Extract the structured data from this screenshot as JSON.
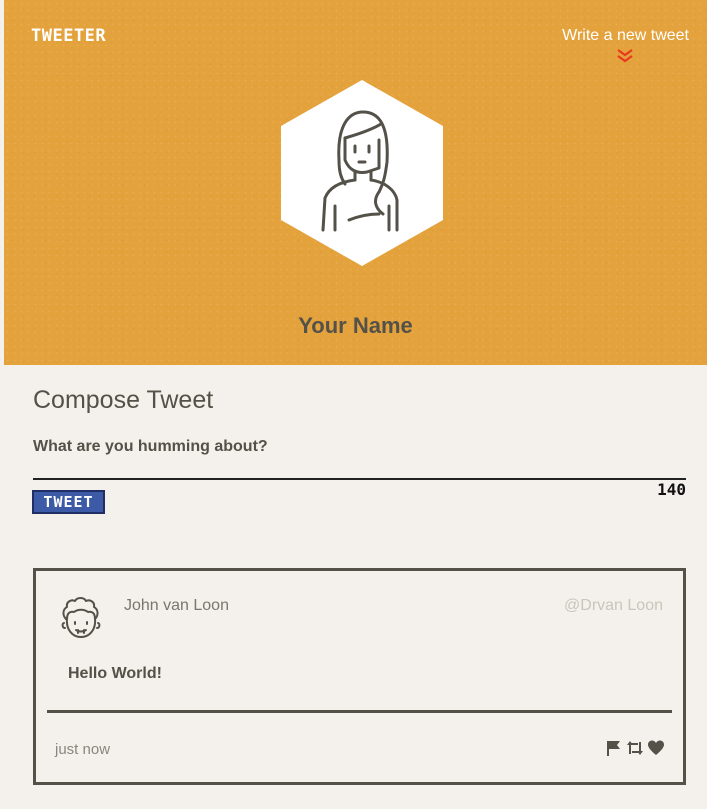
{
  "header": {
    "brand": "TWEETER",
    "write_link": "Write a new tweet",
    "profile_name": "Your Name"
  },
  "compose": {
    "title": "Compose Tweet",
    "label": "What are you humming about?",
    "input_value": "",
    "counter": "140",
    "button_label": "TWEET"
  },
  "tweets": [
    {
      "author": "John van Loon",
      "handle": "@Drvan Loon",
      "body": "Hello World!",
      "time": "just now"
    }
  ],
  "icons": {
    "write_link": "double-chevron-down-icon",
    "avatar": "girl-avatar-icon",
    "tweet_avatar": "curly-hair-man-avatar-icon",
    "actions": [
      "flag-icon",
      "retweet-icon",
      "heart-icon"
    ]
  },
  "colors": {
    "header_bg": "#e4a23c",
    "page_bg": "#f4f1ec",
    "text": "#545149",
    "chevron": "#e8391d",
    "tweet_button": "#3d5aa6"
  }
}
